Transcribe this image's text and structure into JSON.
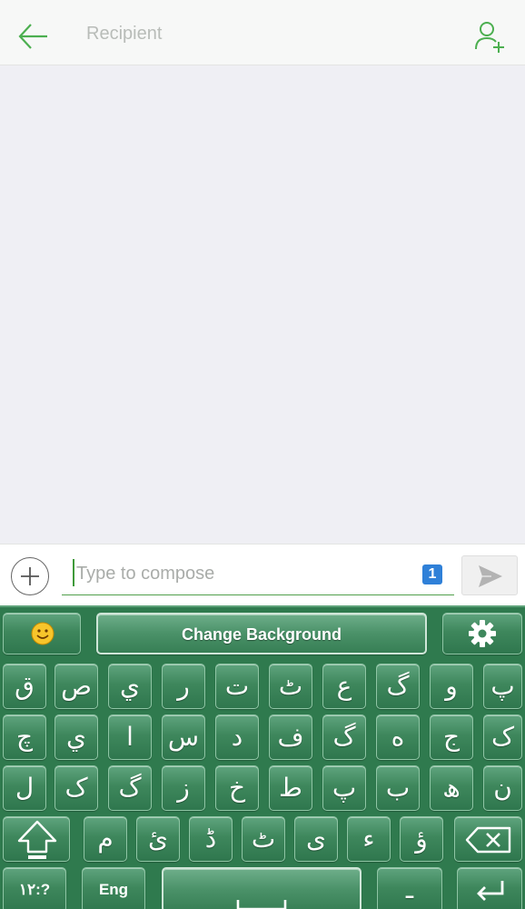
{
  "header": {
    "recipient_placeholder": "Recipient",
    "back_icon": "arrow-left-icon",
    "add_contact_icon": "add-contact-icon",
    "accent_color": "#4caf50"
  },
  "compose": {
    "placeholder": "Type to compose",
    "value": "",
    "sim_badge": "1",
    "attach_icon": "plus-icon",
    "send_icon": "send-icon"
  },
  "keyboard": {
    "theme_color": "#2f7a4e",
    "top_row": {
      "emoji_icon": "emoji-icon",
      "change_background": "Change Background",
      "settings_icon": "gear-icon"
    },
    "rows": [
      [
        "ق",
        "ص",
        "ي",
        "ر",
        "ت",
        "ٹ",
        "ع",
        "گ",
        "و",
        "پ"
      ],
      [
        "چ",
        "ي",
        "ا",
        "س",
        "د",
        "ف",
        "گ",
        "ه",
        "ج",
        "ک"
      ],
      [
        "ل",
        "ک",
        "گ",
        "ز",
        "خ",
        "ط",
        "پ",
        "ب",
        "ھ",
        "ن"
      ],
      [
        "م",
        "ئ",
        "ڈ",
        "ٹ",
        "ی",
        "ء",
        "ؤ"
      ]
    ],
    "bottom_row": {
      "numbers": "١٢:?",
      "lang": "Eng",
      "shift_icon": "shift-icon",
      "backspace_icon": "backspace-icon",
      "space_icon": "space-icon",
      "enter_icon": "enter-icon",
      "dash": "ـ"
    }
  }
}
